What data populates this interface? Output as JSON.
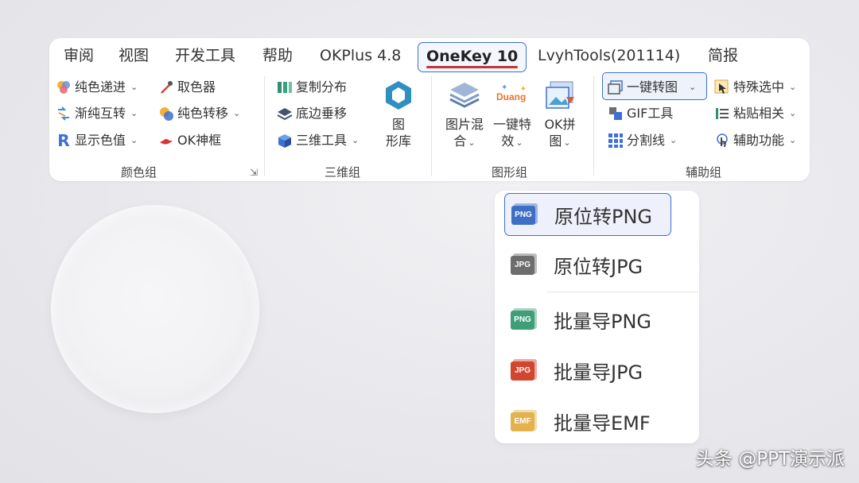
{
  "ribbon": {
    "tabs": [
      {
        "label": "审阅"
      },
      {
        "label": "视图"
      },
      {
        "label": "开发工具"
      },
      {
        "label": "帮助"
      },
      {
        "label": "OKPlus 4.8"
      },
      {
        "label": "OneKey 10",
        "active": true
      },
      {
        "label": "LvyhTools(201114)"
      },
      {
        "label": "简报"
      }
    ],
    "groups": {
      "color": {
        "label": "颜色组",
        "items": [
          "纯色递进",
          "渐纯互转",
          "显示色值",
          "取色器",
          "纯色转移",
          "OK神框"
        ]
      },
      "three_d": {
        "label": "三维组",
        "items": [
          "复制分布",
          "底边垂移",
          "三维工具"
        ],
        "big_button": {
          "line1": "图",
          "line2": "形库"
        }
      },
      "shape": {
        "label": "图形组",
        "big_buttons": [
          {
            "line1": "图片混",
            "line2": "合"
          },
          {
            "line1": "一键特",
            "line2": "效",
            "icon_text": "Duang"
          },
          {
            "line1": "OK拼",
            "line2": "图"
          }
        ]
      },
      "assist": {
        "label": "辅助组",
        "items": [
          "一键转图",
          "GIF工具",
          "分割线",
          "特殊选中",
          "粘贴相关",
          "辅助功能"
        ]
      }
    }
  },
  "dropdown": {
    "items": [
      {
        "label": "原位转PNG",
        "badge": "PNG",
        "color": "#3f6fc4",
        "highlighted": true
      },
      {
        "label": "原位转JPG",
        "badge": "JPG",
        "color": "#6d6d6d"
      },
      {
        "label": "批量导PNG",
        "badge": "PNG",
        "color": "#3e9e78"
      },
      {
        "label": "批量导JPG",
        "badge": "JPG",
        "color": "#d2452e"
      },
      {
        "label": "批量导EMF",
        "badge": "EMF",
        "color": "#e3b24c"
      }
    ]
  },
  "watermark": "头条 @PPT演示派",
  "colors": {
    "accent": "#3d6fd4",
    "active_underline": "#b83a3a"
  }
}
